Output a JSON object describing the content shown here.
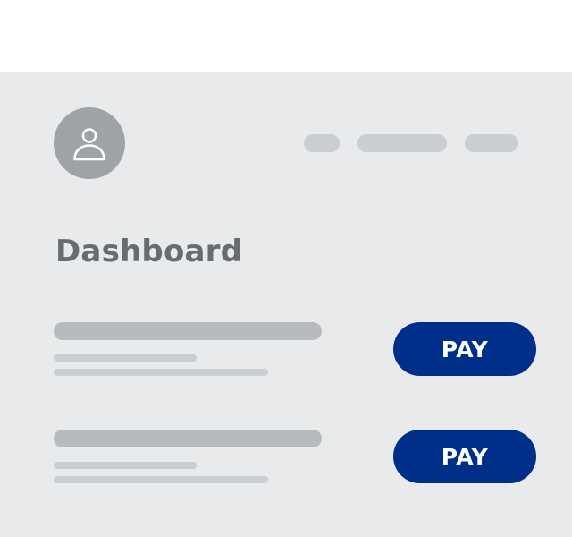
{
  "header": {
    "avatar_icon": "user-icon"
  },
  "page": {
    "title": "Dashboard"
  },
  "payments": [
    {
      "button_label": "PAY"
    },
    {
      "button_label": "PAY"
    }
  ],
  "colors": {
    "accent": "#002f8a",
    "background": "#e8eaec",
    "title_text": "#666d70",
    "avatar": "#a0a3a6",
    "placeholder_dark": "#b6bbbd",
    "placeholder_light": "#c9ced2"
  }
}
